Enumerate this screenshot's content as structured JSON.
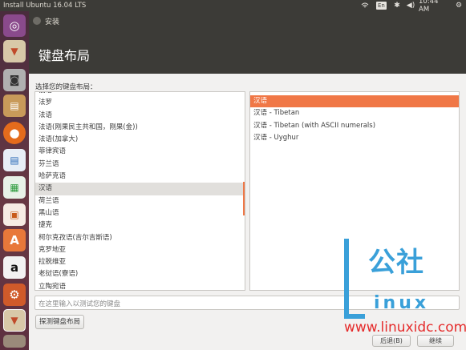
{
  "topbar": {
    "title": "Install Ubuntu 16.04 LTS",
    "keyboard_indicator": "En",
    "clock": "10:44 AM",
    "icons": [
      "wifi-icon",
      "keyboard-indicator",
      "bluetooth-icon",
      "volume-icon",
      "gear-icon"
    ]
  },
  "launcher": {
    "items": [
      "ubuntu-logo-icon",
      "installer-icon",
      "camera-icon",
      "file-manager-icon",
      "firefox-icon",
      "writer-icon",
      "calc-icon",
      "impress-icon",
      "software-center-icon",
      "amazon-icon",
      "settings-icon",
      "installer-running-icon",
      "trash-icon"
    ]
  },
  "window": {
    "title": "安装",
    "heading": "键盘布局",
    "prompt": "选择您的键盘布局：",
    "layouts": [
      "俄语",
      "法罗",
      "法语",
      "法语(刚果民主共和国，刚果(金))",
      "法语(加拿大)",
      "菲律宾语",
      "芬兰语",
      "哈萨克语",
      "汉语",
      "荷兰语",
      "黑山语",
      "捷克",
      "柯尔克孜语(吉尔吉斯语)",
      "克罗地亚",
      "拉脱维亚",
      "老挝语(寮语)",
      "立陶宛语"
    ],
    "selected_layout": "汉语",
    "variants": [
      "汉语",
      "汉语 - Tibetan",
      "汉语 - Tibetan (with ASCII numerals)",
      "汉语 - Uyghur"
    ],
    "selected_variant": "汉语",
    "test_placeholder": "在这里输入以测试您的键盘",
    "detect_button": "探测键盘布局",
    "back_button": "后退(B)",
    "continue_button": "继续"
  },
  "watermark": {
    "chinese": "公社",
    "linux": "inux",
    "url": "www.linuxidc.com"
  }
}
